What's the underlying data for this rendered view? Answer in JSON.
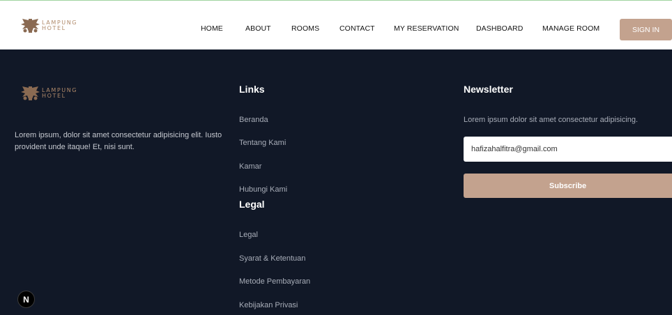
{
  "brand": {
    "line1": "LAMPUNG",
    "line2": "HOTEL"
  },
  "nav": {
    "items": [
      "HOME",
      "ABOUT",
      "ROOMS",
      "CONTACT",
      "MY RESERVATION",
      "DASHBOARD",
      "MANAGE ROOM"
    ],
    "signin_label": "SIGN IN"
  },
  "footer": {
    "brand": {
      "line1": "LAMPUNG",
      "line2": "HOTEL"
    },
    "description": "Lorem ipsum, dolor sit amet consectetur adipisicing elit. Iusto provident unde itaque! Et, nisi sunt.",
    "links": {
      "title": "Links",
      "items": [
        "Beranda",
        "Tentang Kami",
        "Kamar",
        "Hubungi Kami"
      ]
    },
    "legal": {
      "title": "Legal",
      "items": [
        "Legal",
        "Syarat & Ketentuan",
        "Metode Pembayaran",
        "Kebijakan Privasi"
      ]
    },
    "newsletter": {
      "title": "Newsletter",
      "text": "Lorem ipsum dolor sit amet consectetur adipisicing.",
      "email_value": "hafizahalfitra@gmail.com",
      "button_label": "Subscribe"
    }
  },
  "dev_badge": {
    "letter": "N"
  },
  "colors": {
    "accent": "#c3a28e",
    "footer_bg": "#111827",
    "brand_text": "#b08a6a"
  }
}
